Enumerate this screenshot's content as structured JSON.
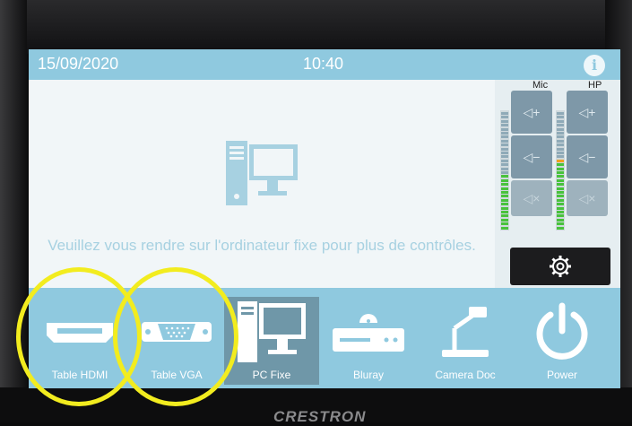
{
  "header": {
    "date": "15/09/2020",
    "time": "10:40",
    "info_icon": "i"
  },
  "content": {
    "message": "Veuillez vous rendre sur l'ordinateur fixe pour plus de contrôles."
  },
  "audio": {
    "mic_label": "Mic",
    "hp_label": "HP",
    "vol_up": "+",
    "vol_down": "−",
    "mute": "×"
  },
  "sources": [
    {
      "label": "Table HDMI",
      "icon": "hdmi-icon"
    },
    {
      "label": "Table VGA",
      "icon": "vga-icon"
    },
    {
      "label": "PC Fixe",
      "icon": "computer-icon",
      "selected": true
    },
    {
      "label": "Bluray",
      "icon": "bluray-player-icon"
    },
    {
      "label": "Camera Doc",
      "icon": "document-camera-icon"
    },
    {
      "label": "Power",
      "icon": "power-icon"
    }
  ],
  "brand": "CRESTRON",
  "colors": {
    "header": "#8fc9df",
    "content": "#f1f6f8",
    "selected_source": "#6f97a8",
    "highlight": "#f2ec1f"
  }
}
